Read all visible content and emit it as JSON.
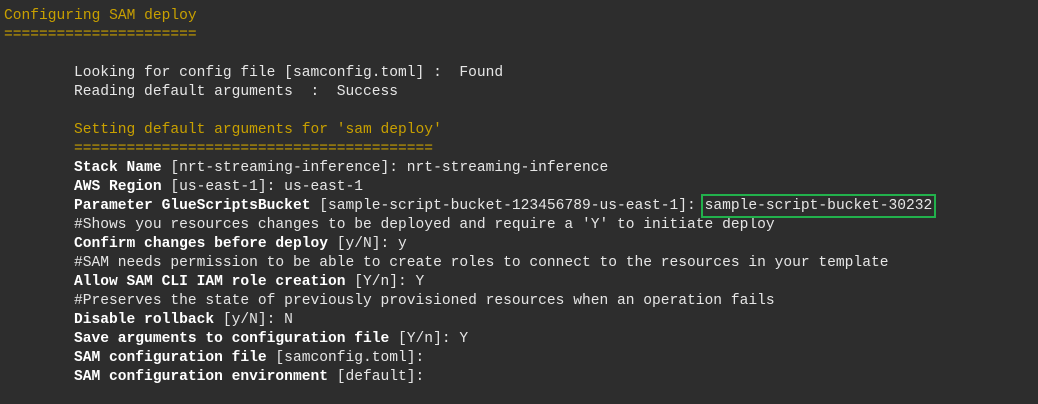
{
  "title": "Configuring SAM deploy",
  "title_rule": "======================",
  "lookup": {
    "text": "Looking for config file [samconfig.toml] :  Found"
  },
  "reading": {
    "text": "Reading default arguments  :  Success"
  },
  "section": {
    "title": "Setting default arguments for 'sam deploy'",
    "rule": "========================================="
  },
  "prompts": [
    {
      "label": "Stack Name",
      "rest": " [nrt-streaming-inference]: nrt-streaming-inference"
    },
    {
      "label": "AWS Region",
      "rest": " [us-east-1]: us-east-1"
    },
    {
      "label": "Parameter GlueScriptsBucket",
      "rest": " [sample-script-bucket-123456789-us-east-1]: ",
      "value": "sample-script-bucket-30232"
    },
    {
      "comment": "#Shows you resources changes to be deployed and require a 'Y' to initiate deploy"
    },
    {
      "label": "Confirm changes before deploy",
      "rest": " [y/N]: y"
    },
    {
      "comment": "#SAM needs permission to be able to create roles to connect to the resources in your template"
    },
    {
      "label": "Allow SAM CLI IAM role creation",
      "rest": " [Y/n]: Y"
    },
    {
      "comment": "#Preserves the state of previously provisioned resources when an operation fails"
    },
    {
      "label": "Disable rollback",
      "rest": " [y/N]: N"
    },
    {
      "label": "Save arguments to configuration file",
      "rest": " [Y/n]: Y"
    },
    {
      "label": "SAM configuration file",
      "rest": " [samconfig.toml]:"
    },
    {
      "label": "SAM configuration environment",
      "rest": " [default]:"
    }
  ],
  "colors": {
    "background": "#2d2d2d",
    "heading": "#c8a000",
    "highlight": "#22b14c"
  }
}
